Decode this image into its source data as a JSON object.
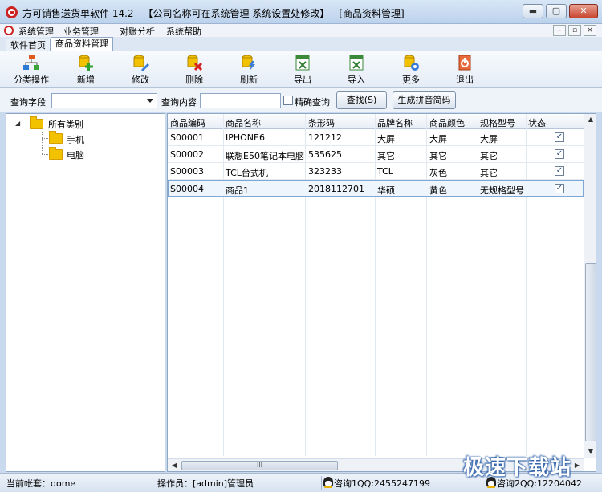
{
  "window": {
    "title": "方可销售送货单软件 14.2 - 【公司名称可在系统管理 系统设置处修改】 - [商品资料管理]",
    "buttons": {
      "minimize": "▬",
      "maximize": "▢",
      "close": "✕"
    }
  },
  "menubar": {
    "items": [
      "系统管理",
      "业务管理",
      "对账分析",
      "系统帮助"
    ],
    "mdi": {
      "minimize": "–",
      "restore": "▫",
      "close": "×"
    }
  },
  "tabs": [
    "软件首页",
    "商品资料管理"
  ],
  "toolbar": {
    "items": [
      {
        "label": "分类操作",
        "icon": "category-icon"
      },
      {
        "label": "新增",
        "icon": "add-icon"
      },
      {
        "label": "修改",
        "icon": "edit-icon"
      },
      {
        "label": "删除",
        "icon": "delete-icon"
      },
      {
        "label": "刷新",
        "icon": "refresh-icon"
      },
      {
        "label": "导出",
        "icon": "export-icon"
      },
      {
        "label": "导入",
        "icon": "import-icon"
      },
      {
        "label": "更多",
        "icon": "more-icon"
      },
      {
        "label": "退出",
        "icon": "exit-icon"
      }
    ]
  },
  "query": {
    "field_label": "查询字段",
    "field_value": "",
    "content_label": "查询内容",
    "content_value": "",
    "exact_label": "精确查询",
    "exact_checked": false,
    "search_button": "查找(S)",
    "pinyin_button": "生成拼音简码"
  },
  "tree": {
    "root": "所有类别",
    "toggle": "◢",
    "children": [
      "手机",
      "电脑"
    ]
  },
  "grid": {
    "columns": [
      "商品编码",
      "商品名称",
      "条形码",
      "品牌名称",
      "商品颜色",
      "规格型号",
      "状态"
    ],
    "rows": [
      {
        "code": "S00001",
        "name": "IPHONE6",
        "barcode": "121212",
        "brand": "大屏",
        "color": "大屏",
        "spec": "大屏",
        "status": true
      },
      {
        "code": "S00002",
        "name": "联想E50笔记本电脑",
        "barcode": "535625",
        "brand": "其它",
        "color": "其它",
        "spec": "其它",
        "status": true
      },
      {
        "code": "S00003",
        "name": "TCL台式机",
        "barcode": "323233",
        "brand": "TCL",
        "color": "灰色",
        "spec": "其它",
        "status": true
      },
      {
        "code": "S00004",
        "name": "商品1",
        "barcode": "2018112701",
        "brand": "华硕",
        "color": "黄色",
        "spec": "无规格型号",
        "status": true
      }
    ],
    "check_glyph": "✓",
    "scroll": {
      "up": "▲",
      "down": "▼",
      "left": "◀",
      "right": "▶",
      "grip": "III"
    }
  },
  "statusbar": {
    "account": "当前帐套：dome",
    "operator": "操作员：[admin]管理员",
    "qq1": "咨询1QQ:2455247199",
    "qq2": "咨询2QQ:12204042",
    "watermark": "极速下载站"
  },
  "colors": {
    "accent": "#2c5fa8",
    "folder": "#f2c200",
    "close_button": "#c8452f"
  }
}
